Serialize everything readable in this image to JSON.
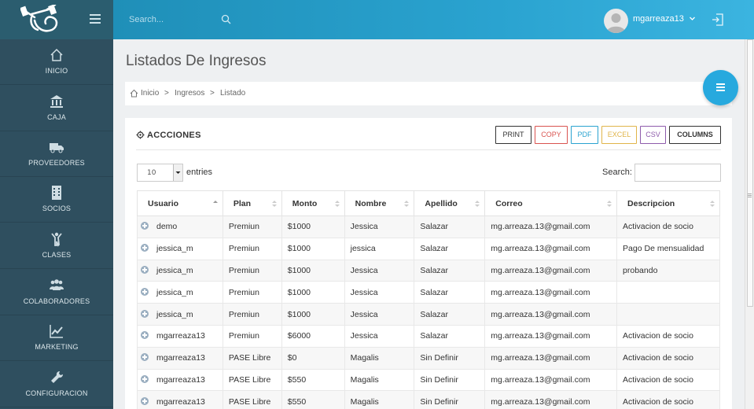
{
  "header": {
    "search_placeholder": "Search...",
    "username": "mgarreaza13"
  },
  "sidebar": {
    "items": [
      {
        "label": "INICIO",
        "icon": "home-icon"
      },
      {
        "label": "CAJA",
        "icon": "bank-icon"
      },
      {
        "label": "PROVEEDORES",
        "icon": "truck-icon"
      },
      {
        "label": "SOCIOS",
        "icon": "building-icon"
      },
      {
        "label": "CLASES",
        "icon": "person-icon"
      },
      {
        "label": "COLABORADORES",
        "icon": "users-icon"
      },
      {
        "label": "MARKETING",
        "icon": "chart-icon"
      },
      {
        "label": "CONFIGURACION",
        "icon": "wrench-icon"
      }
    ]
  },
  "page": {
    "title": "Listados De Ingresos",
    "breadcrumb": [
      "Inicio",
      ">",
      "Ingresos",
      ">",
      "Listado"
    ]
  },
  "card": {
    "title": "ACCCIONES",
    "buttons": [
      {
        "label": "PRINT",
        "color": "#333333"
      },
      {
        "label": "COPY",
        "color": "#d9534f"
      },
      {
        "label": "PDF",
        "color": "#2aa3d0"
      },
      {
        "label": "EXCEL",
        "color": "#e0b44a"
      },
      {
        "label": "CSV",
        "color": "#8e5bab"
      },
      {
        "label": "COLUMNS",
        "color": "#333333"
      }
    ],
    "entries_value": "10",
    "entries_label": "entries",
    "search_label": "Search:"
  },
  "table": {
    "columns": [
      "Usuario",
      "Plan",
      "Monto",
      "Nombre",
      "Apellido",
      "Correo",
      "Descripcion"
    ],
    "rows": [
      [
        "demo",
        "Premiun",
        "$1000",
        "Jessica",
        "Salazar",
        "mg.arreaza.13@gmail.com",
        "Activacion de socio"
      ],
      [
        "jessica_m",
        "Premiun",
        "$1000",
        "jessica",
        "Salazar",
        "mg.arreaza.13@gmail.com",
        "Pago De mensualidad"
      ],
      [
        "jessica_m",
        "Premiun",
        "$1000",
        "Jessica",
        "Salazar",
        "mg.arreaza.13@gmail.com",
        "probando"
      ],
      [
        "jessica_m",
        "Premiun",
        "$1000",
        "Jessica",
        "Salazar",
        "mg.arreaza.13@gmail.com",
        ""
      ],
      [
        "jessica_m",
        "Premiun",
        "$1000",
        "Jessica",
        "Salazar",
        "mg.arreaza.13@gmail.com",
        ""
      ],
      [
        "mgarreaza13",
        "Premiun",
        "$6000",
        "Jessica",
        "Salazar",
        "mg.arreaza.13@gmail.com",
        "Activacion de socio"
      ],
      [
        "mgarreaza13",
        "PASE Libre",
        "$0",
        "Magalis",
        "Sin Definir",
        "mg.arreaza.13@gmail.com",
        "Activacion de socio"
      ],
      [
        "mgarreaza13",
        "PASE Libre",
        "$550",
        "Magalis",
        "Sin Definir",
        "mg.arreaza.13@gmail.com",
        "Activacion de socio"
      ],
      [
        "mgarreaza13",
        "PASE Libre",
        "$550",
        "Magalis",
        "Sin Definir",
        "mg.arreaza.13@gmail.com",
        "Activacion de socio"
      ]
    ]
  }
}
